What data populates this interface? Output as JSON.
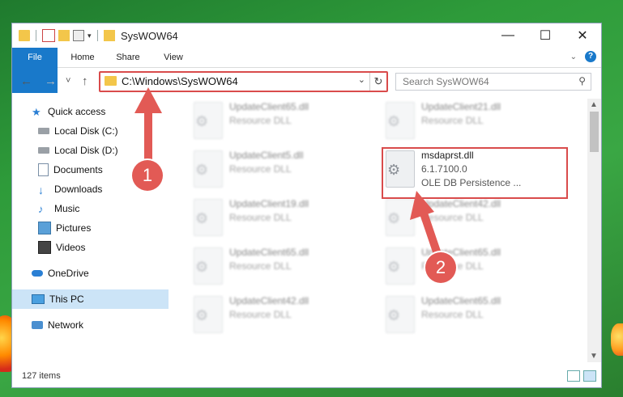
{
  "window": {
    "title": "SysWOW64",
    "controls": [
      "—",
      "☐",
      "✕"
    ]
  },
  "ribbon": {
    "tabs": [
      "File",
      "Home",
      "Share",
      "View"
    ],
    "help": "?"
  },
  "navigation": {
    "back": "←",
    "forward": "→",
    "recent": "˅",
    "up": "↑",
    "address": "C:\\Windows\\SysWOW64",
    "address_dropdown": "⌄",
    "refresh": "↻",
    "search_placeholder": "Search SysWOW64"
  },
  "sidebar": {
    "items": [
      {
        "label": "Quick access",
        "icon": "star-icon",
        "pinned": false
      },
      {
        "label": "Local Disk (C:)",
        "icon": "drive-icon",
        "pinned": true
      },
      {
        "label": "Local Disk (D:)",
        "icon": "drive-icon",
        "pinned": true
      },
      {
        "label": "Documents",
        "icon": "documents-icon",
        "pinned": true
      },
      {
        "label": "Downloads",
        "icon": "download-icon",
        "pinned": true
      },
      {
        "label": "Music",
        "icon": "music-icon",
        "pinned": true
      },
      {
        "label": "Pictures",
        "icon": "pictures-icon",
        "pinned": true
      },
      {
        "label": "Videos",
        "icon": "videos-icon",
        "pinned": true
      },
      {
        "label": "OneDrive",
        "icon": "cloud-icon",
        "pinned": false
      },
      {
        "label": "This PC",
        "icon": "computer-icon",
        "pinned": false,
        "selected": true
      },
      {
        "label": "Network",
        "icon": "network-icon",
        "pinned": false
      }
    ]
  },
  "files": [
    {
      "name": "UpdateClient65.dll",
      "line2": "Resource DLL",
      "line3": ""
    },
    {
      "name": "UpdateClient21.dll",
      "line2": "Resource DLL",
      "line3": ""
    },
    {
      "name": "UpdateClient5.dll",
      "line2": "Resource DLL",
      "line3": ""
    },
    {
      "name": "msdaprst.dll",
      "line2": "6.1.7100.0",
      "line3": "OLE DB Persistence ..."
    },
    {
      "name": "UpdateClient19.dll",
      "line2": "Resource DLL",
      "line3": ""
    },
    {
      "name": "UpdateClient42.dll",
      "line2": "Resource DLL",
      "line3": ""
    },
    {
      "name": "UpdateClient65.dll",
      "line2": "Resource DLL",
      "line3": ""
    },
    {
      "name": "UpdateClient65.dll",
      "line2": "Resource DLL",
      "line3": ""
    },
    {
      "name": "UpdateClient42.dll",
      "line2": "Resource DLL",
      "line3": ""
    },
    {
      "name": "UpdateClient65.dll",
      "line2": "Resource DLL",
      "line3": ""
    }
  ],
  "status": {
    "item_count": "127 items"
  },
  "annotations": {
    "badge1": "1",
    "badge2": "2",
    "color": "#e25a55"
  }
}
